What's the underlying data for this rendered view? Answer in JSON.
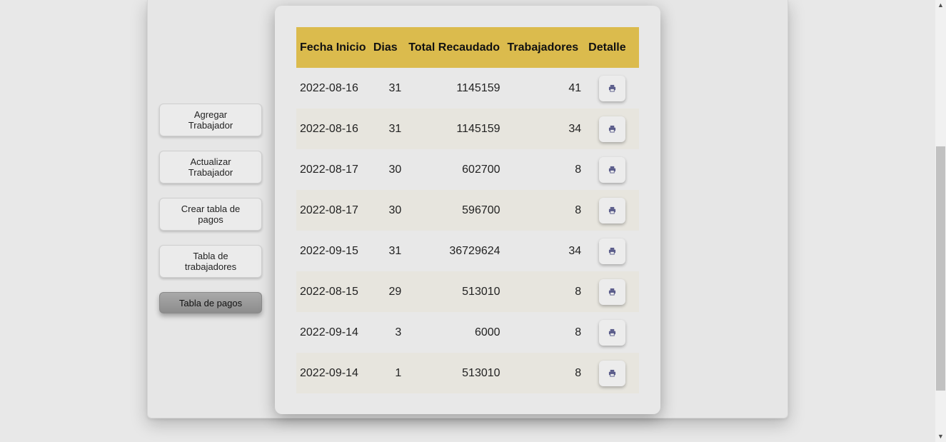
{
  "sidebar": {
    "items": [
      {
        "label": "Agregar Trabajador"
      },
      {
        "label": "Actualizar Trabajador"
      },
      {
        "label": "Crear tabla de pagos"
      },
      {
        "label": "Tabla de trabajadores"
      },
      {
        "label": "Tabla de pagos",
        "active": true
      }
    ]
  },
  "table": {
    "headers": {
      "fecha_inicio": "Fecha Inicio",
      "dias": "Dias",
      "total_recaudado": "Total Recaudado",
      "trabajadores": "Trabajadores",
      "detalle": "Detalle"
    },
    "rows": [
      {
        "fecha": "2022-08-16",
        "dias": "31",
        "total": "1145159",
        "trabajadores": "41"
      },
      {
        "fecha": "2022-08-16",
        "dias": "31",
        "total": "1145159",
        "trabajadores": "34"
      },
      {
        "fecha": "2022-08-17",
        "dias": "30",
        "total": "602700",
        "trabajadores": "8"
      },
      {
        "fecha": "2022-08-17",
        "dias": "30",
        "total": "596700",
        "trabajadores": "8"
      },
      {
        "fecha": "2022-09-15",
        "dias": "31",
        "total": "36729624",
        "trabajadores": "34"
      },
      {
        "fecha": "2022-08-15",
        "dias": "29",
        "total": "513010",
        "trabajadores": "8"
      },
      {
        "fecha": "2022-09-14",
        "dias": "3",
        "total": "6000",
        "trabajadores": "8"
      },
      {
        "fecha": "2022-09-14",
        "dias": "1",
        "total": "513010",
        "trabajadores": "8"
      }
    ],
    "detail_icon": "printer-icon"
  },
  "colors": {
    "header_bg": "#dbbb4d",
    "row_alt_bg": "#e7e5de",
    "active_button": "#999999",
    "icon": "#5a5c8a"
  }
}
